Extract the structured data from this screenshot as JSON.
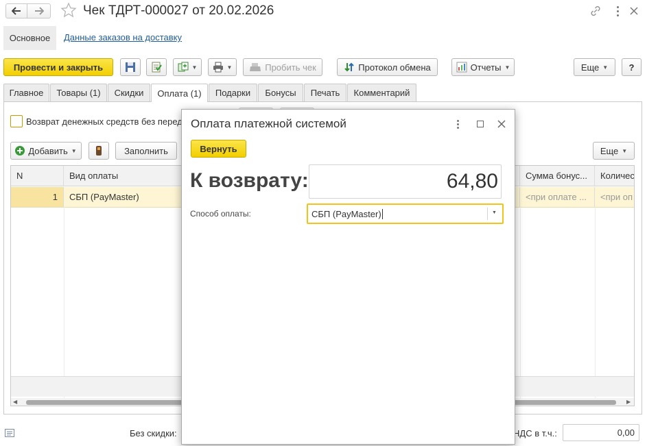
{
  "window": {
    "title": "Чек ТДРТ-000027 от 20.02.2026",
    "nav_back_icon": "arrow-left-icon",
    "nav_forward_icon": "arrow-right-icon",
    "favorite_icon": "star-icon"
  },
  "sections": {
    "main": "Основное",
    "delivery": "Данные заказов на доставку"
  },
  "toolbar": {
    "post_close": "Провести и закрыть",
    "print_check": "Пробить чек",
    "exchange_log": "Протокол обмена",
    "reports": "Отчеты",
    "more": "Еще",
    "help": "?"
  },
  "tabs": [
    {
      "label": "Главное"
    },
    {
      "label": "Товары (1)"
    },
    {
      "label": "Скидки"
    },
    {
      "label": "Оплата (1)"
    },
    {
      "label": "Подарки"
    },
    {
      "label": "Бонусы"
    },
    {
      "label": "Печать"
    },
    {
      "label": "Комментарий"
    }
  ],
  "payment_tab": {
    "refund_checkbox_label": "Возврат денежных средств без перед",
    "refund_checked": false,
    "add_button": "Добавить",
    "fill_button": "Заполнить",
    "more_button": "Еще",
    "columns": {
      "n": "N",
      "payment_type": "Вид оплаты",
      "bonus_sum": "Сумма бонус...",
      "quantity": "Количес"
    },
    "rows": [
      {
        "n": "1",
        "payment_type": "СБП (PayMaster)",
        "bonus_sum": "<при оплате ...",
        "quantity": "<при оп"
      }
    ]
  },
  "footer": {
    "no_discount_label": "Без скидки:",
    "vat_label": "НДС в т.ч.:",
    "vat_value": "0,00"
  },
  "dialog": {
    "title": "Оплата платежной системой",
    "return_button": "Вернуть",
    "to_return_label": "К возврату:",
    "to_return_value": "64,80",
    "method_label": "Способ оплаты:",
    "method_value": "СБП (PayMaster)"
  },
  "colors": {
    "accent_yellow": "#f5d60f",
    "selected_row": "#fdf5d3",
    "focus_border": "#f0c419",
    "link": "#1f5c9e"
  }
}
